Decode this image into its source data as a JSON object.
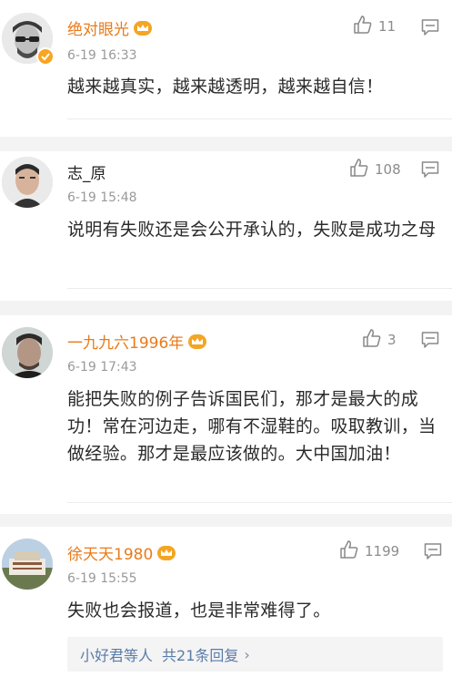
{
  "comments": [
    {
      "username": "绝对眼光",
      "vip": true,
      "verified": true,
      "time": "6-19 16:33",
      "likes": "11",
      "text": "越来越真实，越来越透明，越来越自信！"
    },
    {
      "username": "志_原",
      "vip": false,
      "verified": false,
      "time": "6-19 15:48",
      "likes": "108",
      "text": "说明有失败还是会公开承认的，失败是成功之母"
    },
    {
      "username": "一九九六1996年",
      "vip": true,
      "verified": false,
      "time": "6-19 17:43",
      "likes": "3",
      "text": "能把失败的例子告诉国民们，那才是最大的成功！常在河边走，哪有不湿鞋的。吸取教训，当做经验。那才是最应该做的。大中国加油！"
    },
    {
      "username": "徐天天1980",
      "vip": true,
      "verified": false,
      "time": "6-19 15:55",
      "likes": "1199",
      "text": "失败也会报道，也是非常难得了。",
      "replies": {
        "users": "小好君等人",
        "summary": "共21条回复",
        "chevron": "›"
      }
    }
  ],
  "icons": {
    "like": "thumbs-up-icon",
    "reply": "comment-icon",
    "vip": "crown-icon",
    "verified": "verified-badge-icon"
  },
  "colors": {
    "vip_name": "#ea7a1a",
    "link": "#5a7ca8",
    "time": "#9a9a9a",
    "badge": "#f6a623"
  }
}
